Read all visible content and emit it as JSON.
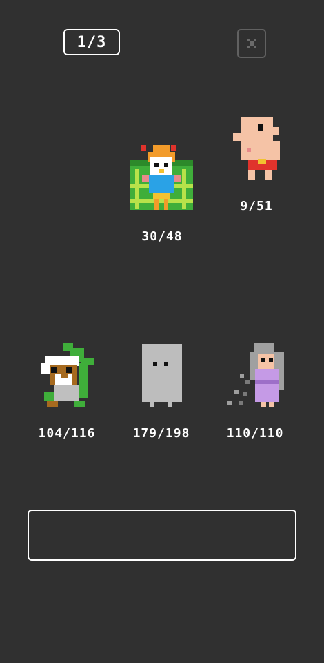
{
  "header": {
    "page_indicator": "1/3"
  },
  "close_button": {
    "icon": "close-icon"
  },
  "characters": [
    {
      "name": "flower-knight",
      "icon": "flower-knight-icon",
      "hp": "30/48"
    },
    {
      "name": "bald-man",
      "icon": "bald-man-icon",
      "hp": "9/51"
    },
    {
      "name": "hooded-bear",
      "icon": "hooded-bear-icon",
      "hp": "104/116"
    },
    {
      "name": "ghost-block",
      "icon": "ghost-block-icon",
      "hp": "179/198"
    },
    {
      "name": "old-lady",
      "icon": "old-lady-icon",
      "hp": "110/110"
    }
  ],
  "message_box": {
    "text": ""
  },
  "colors": {
    "background": "#303030",
    "text": "#ffffff",
    "close_border": "#616161"
  }
}
